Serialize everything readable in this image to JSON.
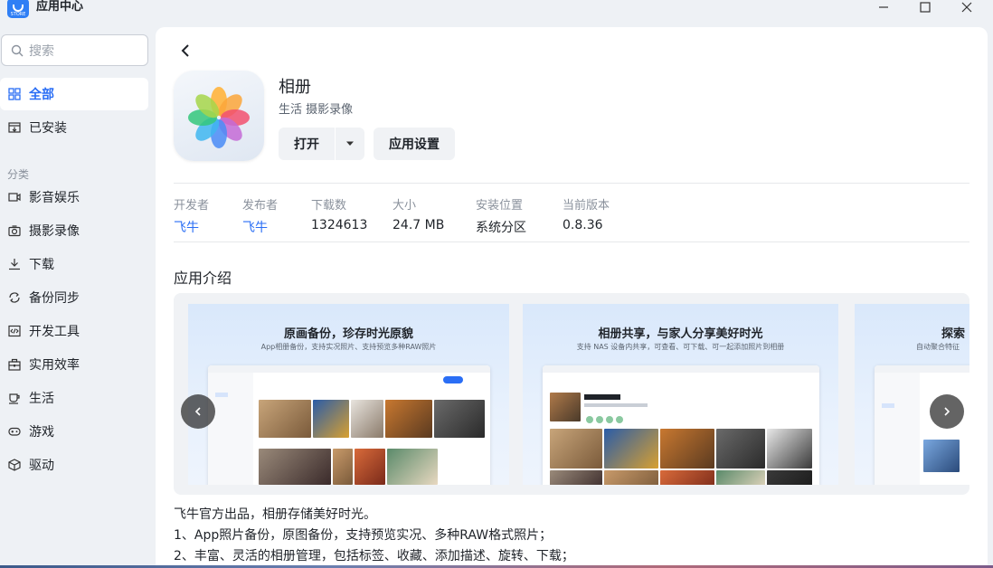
{
  "window": {
    "title": "应用中心",
    "logo_text": "STORE"
  },
  "sidebar": {
    "search_placeholder": "搜索",
    "primary": [
      {
        "label": "全部",
        "icon": "grid-icon",
        "active": true
      },
      {
        "label": "已安装",
        "icon": "installed-icon",
        "active": false
      }
    ],
    "section_label": "分类",
    "categories": [
      {
        "label": "影音娱乐",
        "icon": "video-icon"
      },
      {
        "label": "摄影录像",
        "icon": "camera-icon"
      },
      {
        "label": "下载",
        "icon": "download-icon"
      },
      {
        "label": "备份同步",
        "icon": "sync-icon"
      },
      {
        "label": "开发工具",
        "icon": "code-icon"
      },
      {
        "label": "实用效率",
        "icon": "toolbox-icon"
      },
      {
        "label": "生活",
        "icon": "cup-icon"
      },
      {
        "label": "游戏",
        "icon": "gamepad-icon"
      },
      {
        "label": "驱动",
        "icon": "cube-icon"
      }
    ]
  },
  "app": {
    "name": "相册",
    "categories": "生活 摄影录像",
    "open_label": "打开",
    "settings_label": "应用设置",
    "info": [
      {
        "key": "开发者",
        "value": "飞牛",
        "link": true
      },
      {
        "key": "发布者",
        "value": "飞牛",
        "link": true
      },
      {
        "key": "下载数",
        "value": "1324613",
        "link": false
      },
      {
        "key": "大小",
        "value": "24.7 MB",
        "link": false
      },
      {
        "key": "安装位置",
        "value": "系统分区",
        "link": false
      },
      {
        "key": "当前版本",
        "value": "0.8.36",
        "link": false
      }
    ],
    "intro_title": "应用介绍",
    "screenshots": [
      {
        "heading": "原画备份，珍存时光原貌",
        "sub": "App相册备份，支持实况照片、支持预览多种RAW照片"
      },
      {
        "heading": "相册共享，与家人分享美好时光",
        "sub": "支持 NAS 设备内共享，可查看、可下载、可一起添加照片到相册"
      },
      {
        "heading": "探索",
        "sub": "自动聚合特征"
      }
    ],
    "description": [
      "飞牛官方出品，相册存储美好时光。",
      "1、App照片备份，原图备份，支持预览实况、多种RAW格式照片；",
      "2、丰富、灵活的相册管理，包括标签、收藏、添加描述、旋转、下载；"
    ]
  },
  "colors": {
    "accent": "#2a6ef5",
    "sidebar_bg": "#eef1f5"
  }
}
